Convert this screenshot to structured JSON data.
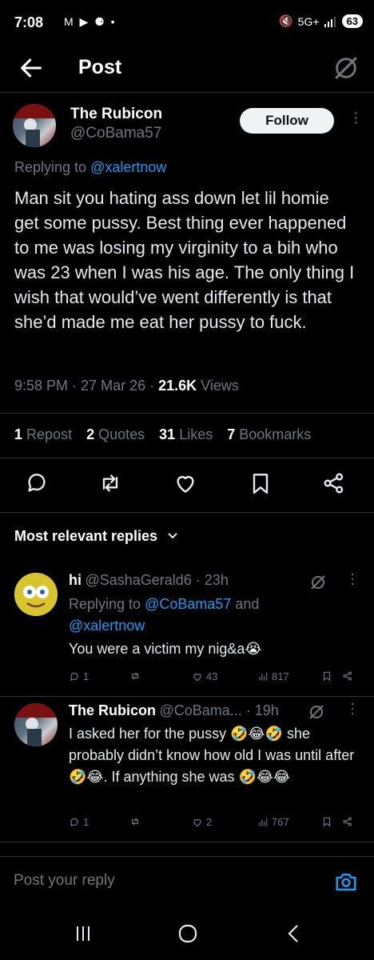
{
  "status_bar": {
    "time": "7:08",
    "left_icons": "M ▶ ⚈ •",
    "network": "5G+",
    "battery": "63"
  },
  "header": {
    "title": "Post"
  },
  "post": {
    "author_name": "The Rubicon",
    "author_handle": "@CoBama57",
    "follow_label": "Follow",
    "replying_prefix": "Replying to ",
    "replying_to": "@xalertnow",
    "text": "Man sit you hating ass down let lil homie get some pussy. Best thing ever happened to me was losing my virginity to a bih who was 23 when I was his age. The only thing I wish that would’ve went differently is that she’d made me eat her pussy to fuck.",
    "time": "9:58 PM",
    "date": "27 Mar 26",
    "views_count": "21.6K",
    "views_label": "Views",
    "stats": [
      {
        "count": "1",
        "label": "Repost"
      },
      {
        "count": "2",
        "label": "Quotes"
      },
      {
        "count": "31",
        "label": "Likes"
      },
      {
        "count": "7",
        "label": "Bookmarks"
      }
    ]
  },
  "replies_header": "Most relevant replies",
  "replies": [
    {
      "name": "hi",
      "handle": "@SashaGerald6 · 23h",
      "replying_prefix": "Replying to ",
      "replying_to_a": "@CoBama57",
      "replying_and": " and",
      "replying_to_b": "@xalertnow",
      "text": "You were a victim my nig&a😭",
      "replies": "1",
      "reposts": "",
      "likes": "43",
      "views": "817"
    },
    {
      "name": "The Rubicon",
      "handle": "@CoBama... · 19h",
      "text": "I asked her for the pussy 🤣😂🤣 she probably didn’t know how old I was until after 🤣😂. If anything she was 🤣😂😂",
      "replies": "1",
      "reposts": "",
      "likes": "2",
      "views": "767"
    }
  ],
  "composer": {
    "placeholder": "Post your reply"
  },
  "colors": {
    "accent": "#1d9bf0",
    "muted": "#71767b",
    "text": "#e7e9ea",
    "background": "#000000"
  }
}
